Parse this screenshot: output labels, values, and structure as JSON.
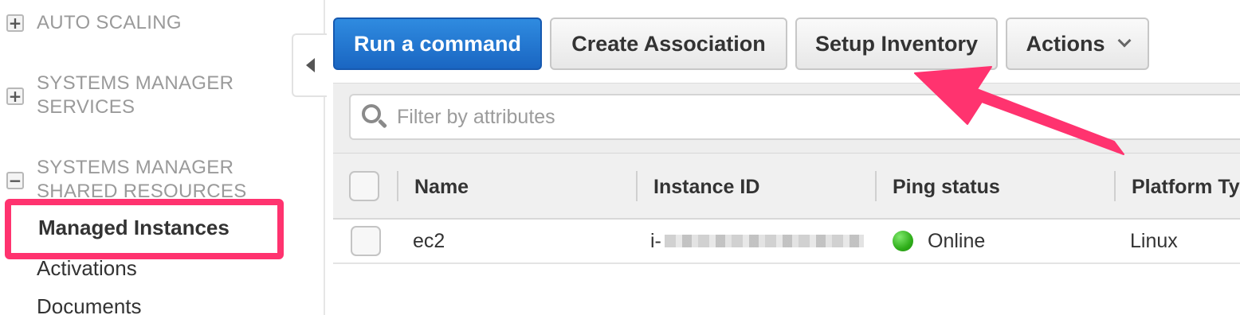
{
  "sidebar": {
    "sections": [
      {
        "label": "AUTO SCALING",
        "toggle": "+"
      },
      {
        "label": "SYSTEMS MANAGER SERVICES",
        "line1": "SYSTEMS MANAGER",
        "line2": "SERVICES",
        "toggle": "+"
      },
      {
        "label": "SYSTEMS MANAGER SHARED RESOURCES",
        "line1": "SYSTEMS MANAGER",
        "line2": "SHARED RESOURCES",
        "toggle": "−"
      }
    ],
    "items": [
      {
        "label": "Managed Instances",
        "selected": true
      },
      {
        "label": "Activations"
      },
      {
        "label": "Documents"
      }
    ]
  },
  "toolbar": {
    "run_command": "Run a command",
    "create_association": "Create Association",
    "setup_inventory": "Setup Inventory",
    "actions": "Actions"
  },
  "filter": {
    "placeholder": "Filter by attributes"
  },
  "table": {
    "columns": [
      "Name",
      "Instance ID",
      "Ping status",
      "Platform Ty"
    ],
    "rows": [
      {
        "name": "ec2",
        "instance_id_prefix": "i-",
        "ping_status": "Online",
        "platform": "Linux"
      }
    ]
  },
  "colors": {
    "primary_button": "#1a66c2",
    "annotation": "#ff336f",
    "status_online": "#2fae1a"
  },
  "icons": {
    "collapse": "triangle-left-icon",
    "search": "magnifier-icon",
    "dropdown": "chevron-down-icon",
    "expand": "plus-square-icon",
    "collapse_section": "minus-square-icon"
  }
}
